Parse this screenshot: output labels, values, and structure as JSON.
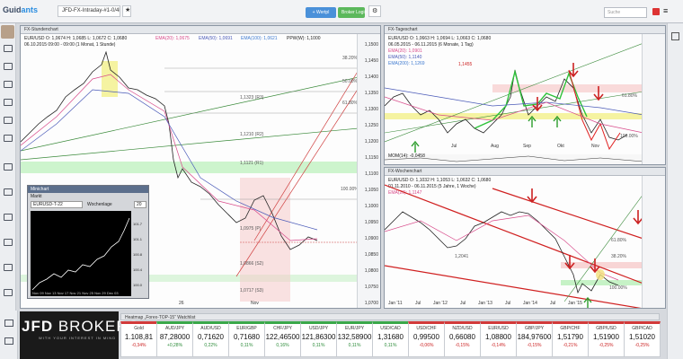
{
  "app": {
    "logo_main": "Guid",
    "logo_accent": "ants",
    "tabs": [
      "JFD-FX-Intraday-#1-0/4h"
    ],
    "btn_watchlist": "+ Wertpl",
    "btn_broker": "Broker Login",
    "search_placeholder": "Suche"
  },
  "panel1": {
    "title": "FX-Stundenchart",
    "info": "EUR/USD  O: 1,0674  H: 1,0685  L: 1,0672  C: 1,0680",
    "ema20": "EMA(20): 1,0675",
    "ema50": "EMA(50): 1,0691",
    "ema100": "EMA(100): 1,0621",
    "ppw": "PPW(W): 1,1000",
    "sub": "06.10.2015 09:00 - 09:00 (1 Monat, 1 Stunde)",
    "levels": [
      "38.20%",
      "50.00%",
      "61.80%",
      "100.00%"
    ],
    "pivots": [
      "1,1323 (R3)",
      "1,1210 (R2)",
      "1,1121 (R1)",
      "1,0975 (P)",
      "1,0866 (S2)",
      "1,0717 (S3)"
    ],
    "yticks": [
      "1,1500",
      "1,1450",
      "1,1400",
      "1,1350",
      "1,1300",
      "1,1250",
      "1,1200",
      "1,1150",
      "1,1100",
      "1,1050",
      "1,1000",
      "1,0950",
      "1,0900",
      "1,0850",
      "1,0800",
      "1,0750",
      "1,0700"
    ],
    "xlabels": [
      "26",
      "Nov"
    ]
  },
  "panel2": {
    "title": "FX-Tageschart",
    "info": "EUR/USD  O: 1,0663  H: 1,0694  L: 1,0663  C: 1,0680",
    "sub": "06.05.2015 - 06.11.2015 (6 Monate, 1 Tag)",
    "ema20": "EMA(20): 1,0901",
    "ema50": "EMA(50): 1,1140",
    "ema200": "EMA(200): 1,1269",
    "level_label": "1,1455",
    "levels": [
      "61.80%",
      "100.00%"
    ],
    "mom": "MOM(14): -0,0458",
    "xlabels": [
      "Jul",
      "Aug",
      "Sep",
      "Okt",
      "Nov"
    ]
  },
  "panel3": {
    "title": "FX-Wochenchart",
    "info": "EUR/USD  O: 1,1032  H: 1,1053  L: 1,0632  C: 1,0680",
    "sub": "01.11.2010 - 06.11.2015 (5 Jahre, 1 Woche)",
    "ema": "EMA(20): 1,1147",
    "level_label": "1,2041",
    "levels": [
      "38.20%",
      "61.80%",
      "100.00%"
    ],
    "xlabels": [
      "Jan '11",
      "Jul",
      "Jan '12",
      "Jul",
      "Jan '13",
      "Jul",
      "Jan '14",
      "Jul",
      "Jan '15"
    ]
  },
  "mini": {
    "title": "Minichart",
    "label": "Markt",
    "symbol": "EURUSD-T-22",
    "setting_label": "Wochenlage",
    "setting_value": "20",
    "ticks": [
      "101.7",
      "101.1",
      "100.8",
      "100.4",
      "100.0"
    ],
    "xlabels": [
      "Nov 09",
      "Nov 13",
      "Nov 17",
      "Nov 21",
      "Nov 25",
      "Nov 29",
      "Dec 03"
    ]
  },
  "sponsor": {
    "name": "JFD",
    "name2": " BROKERS",
    "tagline": "WITH YOUR INTEREST IN MIND"
  },
  "heatmap_title": "Heatmap „Forex-TOP-15“ Watchlist",
  "tickers": [
    {
      "name": "Gold",
      "value": "1.108,81",
      "change": "-0,34%",
      "dir": "down"
    },
    {
      "name": "AUD/JPY",
      "value": "87,28000",
      "change": "+0,28%",
      "dir": "up"
    },
    {
      "name": "AUD/USD",
      "value": "0,71620",
      "change": "0,22%",
      "dir": "up"
    },
    {
      "name": "EUR/GBP",
      "value": "0,71680",
      "change": "0,11%",
      "dir": "up"
    },
    {
      "name": "CHF/JPY",
      "value": "122,46500",
      "change": "0,16%",
      "dir": "up"
    },
    {
      "name": "USD/JPY",
      "value": "121,86300",
      "change": "0,11%",
      "dir": "up"
    },
    {
      "name": "EUR/JPY",
      "value": "132,58900",
      "change": "0,11%",
      "dir": "up"
    },
    {
      "name": "USD/CAD",
      "value": "1,31680",
      "change": "0,11%",
      "dir": "up"
    },
    {
      "name": "USD/CHF",
      "value": "0,99500",
      "change": "-0,06%",
      "dir": "down"
    },
    {
      "name": "NZD/USD",
      "value": "0,66080",
      "change": "-0,15%",
      "dir": "down"
    },
    {
      "name": "EUR/USD",
      "value": "1,08800",
      "change": "-0,14%",
      "dir": "down"
    },
    {
      "name": "GBP/JPY",
      "value": "184,97600",
      "change": "-0,15%",
      "dir": "down"
    },
    {
      "name": "GBP/CHF",
      "value": "1,51790",
      "change": "-0,21%",
      "dir": "down"
    },
    {
      "name": "GBP/USD",
      "value": "1,51900",
      "change": "-0,25%",
      "dir": "down"
    },
    {
      "name": "GBP/CAD",
      "value": "1,51020",
      "change": "-0,25%",
      "dir": "down"
    }
  ],
  "colors": {
    "up": "#3aa84a",
    "down": "#d23a3a",
    "accent": "#2a8de0"
  }
}
